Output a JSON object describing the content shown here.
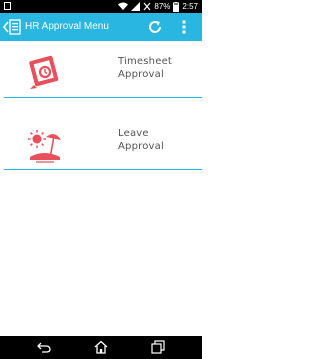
{
  "status_bar": {
    "battery_text": "87%",
    "time": "2:57"
  },
  "app_bar": {
    "title": "HR Approval Menu",
    "icons": [
      "back-arrow-icon",
      "document-icon",
      "refresh-icon",
      "overflow-menu-icon"
    ],
    "color": "#29b6e0"
  },
  "menu": {
    "items": [
      {
        "line1": "Timesheet",
        "line2": "Approval",
        "icon": "timesheet-icon"
      },
      {
        "line1": "Leave",
        "line2": "Approval",
        "icon": "leave-beach-icon"
      }
    ],
    "icon_color": "#e8505b"
  },
  "nav_bar": {
    "icons": [
      "back-icon",
      "home-icon",
      "recent-apps-icon"
    ]
  }
}
